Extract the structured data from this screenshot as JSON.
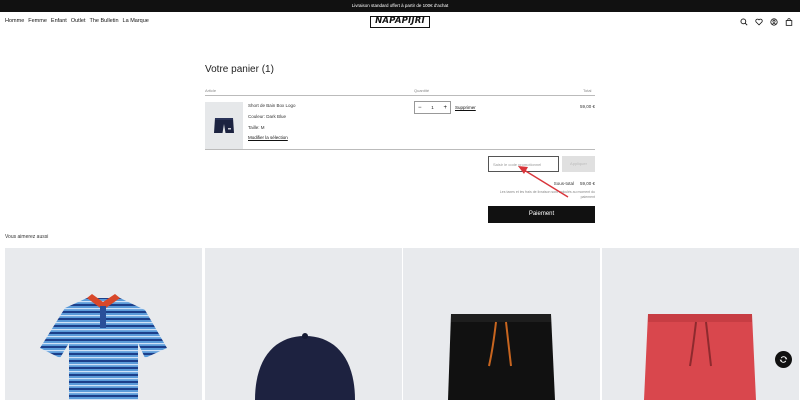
{
  "announcement": "Livraison standard offert à partir de 100€ d'achat",
  "nav": {
    "items": [
      "Homme",
      "Femme",
      "Enfant",
      "Outlet",
      "The Bulletin",
      "La Marque"
    ]
  },
  "brand": {
    "logo_text": "NAPAPIJRI"
  },
  "header_icons": [
    "france-flag-icon",
    "search-icon",
    "heart-icon",
    "account-icon",
    "bag-icon"
  ],
  "cart": {
    "title": "Votre panier (1)",
    "columns": {
      "article": "Article",
      "quantity": "Quantité",
      "total": "Total"
    },
    "item": {
      "name": "Short de Bain Box Logo",
      "color": "Couleur: Dark Blue",
      "size": "Taille: M",
      "edit_link": "Modifier la sélection",
      "quantity": "1",
      "remove": "Supprimer",
      "price": "59,00 €"
    },
    "promo_placeholder": "Saisir le code promotionnel",
    "apply_label": "Appliquer",
    "subtotal_label": "Sous-total",
    "subtotal_value": "59,00 €",
    "tax_note": "Les taxes et les frais de livraison sont calculés au moment du paiement",
    "checkout_label": "Paiement"
  },
  "recommendations": {
    "title": "Vous aimerez aussi",
    "products": [
      "striped-polo-shirt",
      "navy-cap",
      "black-swim-shorts",
      "red-swim-shorts"
    ]
  },
  "colors": {
    "accent_arrow": "#d9353b",
    "dark": "#111111"
  }
}
